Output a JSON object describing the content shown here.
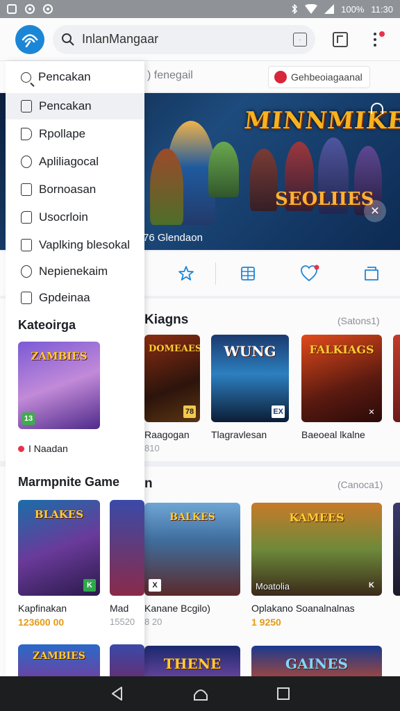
{
  "statusbar": {
    "battery": "100%",
    "time": "11:30"
  },
  "appbar": {
    "search_query": "InlanMangaar"
  },
  "drawer": {
    "menu": [
      {
        "label": "Pencakan",
        "icon": "search-icon"
      },
      {
        "label": "Pencakan",
        "icon": "square-icon"
      },
      {
        "label": "Rpollape",
        "icon": "play-icon"
      },
      {
        "label": "Apliliagocal",
        "icon": "user-icon"
      },
      {
        "label": "Bornoasan",
        "icon": "building-icon"
      },
      {
        "label": "Usocrloin",
        "icon": "document-icon"
      },
      {
        "label": "Vaplking blesokal",
        "icon": "grid-icon"
      },
      {
        "label": "Nepienekaim",
        "icon": "cloud-icon"
      },
      {
        "label": "Gpdeinaa",
        "icon": "settings-icon"
      }
    ],
    "category_heading": "Kateoirga",
    "category_card": {
      "title": "ZAMBIES",
      "badge_left": "13",
      "caption": "I Naadan"
    },
    "section_heading": "Marmpnite Game",
    "game1": {
      "title": "BLAKES",
      "name": "Kapfinakan",
      "price": "123600 00"
    },
    "game2": {
      "name": "Mad",
      "meta": "15520"
    },
    "game3": {
      "title": "ZAMBIES"
    }
  },
  "subbar": {
    "tab": "fenegail",
    "chip": "Gehbeoiagaanal"
  },
  "hero": {
    "title": "MINNMIKEER",
    "subtitle": "SEOLIIES",
    "caption": "Glendaon",
    "prefix": "76"
  },
  "section1": {
    "title": "Kiagns",
    "count": "(Satons1)",
    "cards": [
      {
        "title": "DOMEAES",
        "name": "Raagogan",
        "meta": "810",
        "badge": "78"
      },
      {
        "title": "WUNG",
        "name": "Tlagravlesan",
        "meta": "",
        "badge": "EX"
      },
      {
        "title": "FALKIAGS",
        "name": "Baeoeal lkalne",
        "meta": "",
        "badge": "✕"
      }
    ]
  },
  "section2": {
    "title": "n",
    "count": "(Canoca1)",
    "cards": [
      {
        "title": "BALKES",
        "name": "Kanane Bcgilo)",
        "meta": "8 20",
        "badge": "X"
      },
      {
        "title": "KAMEES",
        "name": "Oplakano Soanalnalnas",
        "meta": "1 9250",
        "badge": "K",
        "overlay": "Moatolia"
      }
    ],
    "bottom": [
      {
        "title": "THENE"
      },
      {
        "title": "GAINES"
      }
    ]
  },
  "colors": {
    "accent": "#1c86d6",
    "price": "#e59a12",
    "badge_red": "#e7334a"
  }
}
